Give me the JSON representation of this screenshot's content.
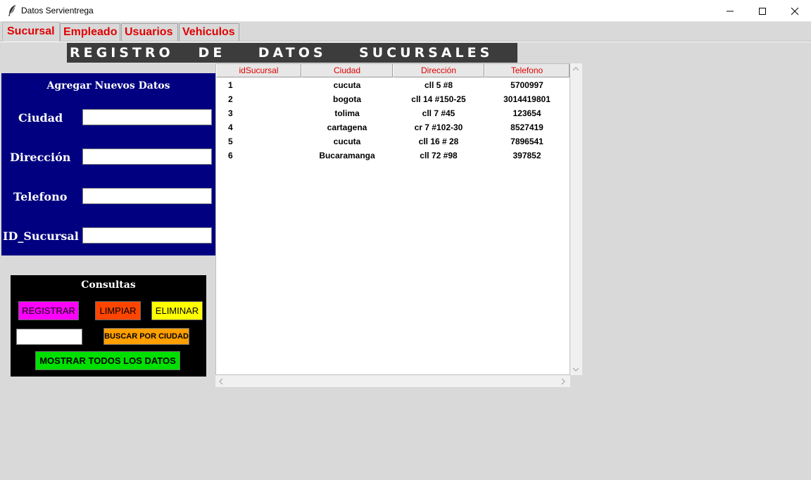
{
  "window": {
    "title": "Datos Servientrega",
    "minimize": "—",
    "maximize": "☐",
    "close": "✕"
  },
  "tabs": [
    {
      "label": "Sucursal",
      "active": true
    },
    {
      "label": "Empleado",
      "active": false
    },
    {
      "label": "Usuarios",
      "active": false
    },
    {
      "label": "Vehiculos",
      "active": false
    }
  ],
  "banner": "REGISTRO   DE    DATOS    SUCURSALES",
  "form": {
    "title": "Agregar Nuevos Datos",
    "fields": [
      {
        "label": "Ciudad",
        "value": ""
      },
      {
        "label": "Dirección",
        "value": ""
      },
      {
        "label": "Telefono",
        "value": ""
      },
      {
        "label": "ID_Sucursal",
        "value": ""
      }
    ]
  },
  "consultas": {
    "title": "Consultas",
    "registrar": "REGISTRAR",
    "limpiar": "LIMPIAR",
    "eliminar": "ELIMINAR",
    "search_value": "",
    "buscar": "BUSCAR POR CIUDAD",
    "mostrar": "MOSTRAR TODOS LOS DATOS"
  },
  "table": {
    "columns": [
      "idSucursal",
      "Ciudad",
      "Dirección",
      "Telefono"
    ],
    "rows": [
      [
        "1",
        "cucuta",
        "cll 5 #8",
        "5700997"
      ],
      [
        "2",
        "bogota",
        "cll 14 #150-25",
        "3014419801"
      ],
      [
        "3",
        "tolima",
        "cll 7 #45",
        "123654"
      ],
      [
        "4",
        "cartagena",
        "cr 7 #102-30",
        "8527419"
      ],
      [
        "5",
        "cucuta",
        "cll 16 # 28",
        "7896541"
      ],
      [
        "6",
        "Bucaramanga",
        "cll 72 #98",
        "397852"
      ]
    ]
  },
  "colors": {
    "form_bg": "#000080",
    "registrar": "#ff00ff",
    "limpiar": "#ff4500",
    "eliminar": "#ffff00",
    "buscar": "#ff9f00",
    "mostrar": "#00e000",
    "tab_text": "#e00000"
  },
  "icons": {
    "app": "feather-icon",
    "scroll_up": "▲",
    "scroll_down": "▼",
    "scroll_left": "◀",
    "scroll_right": "▶"
  }
}
